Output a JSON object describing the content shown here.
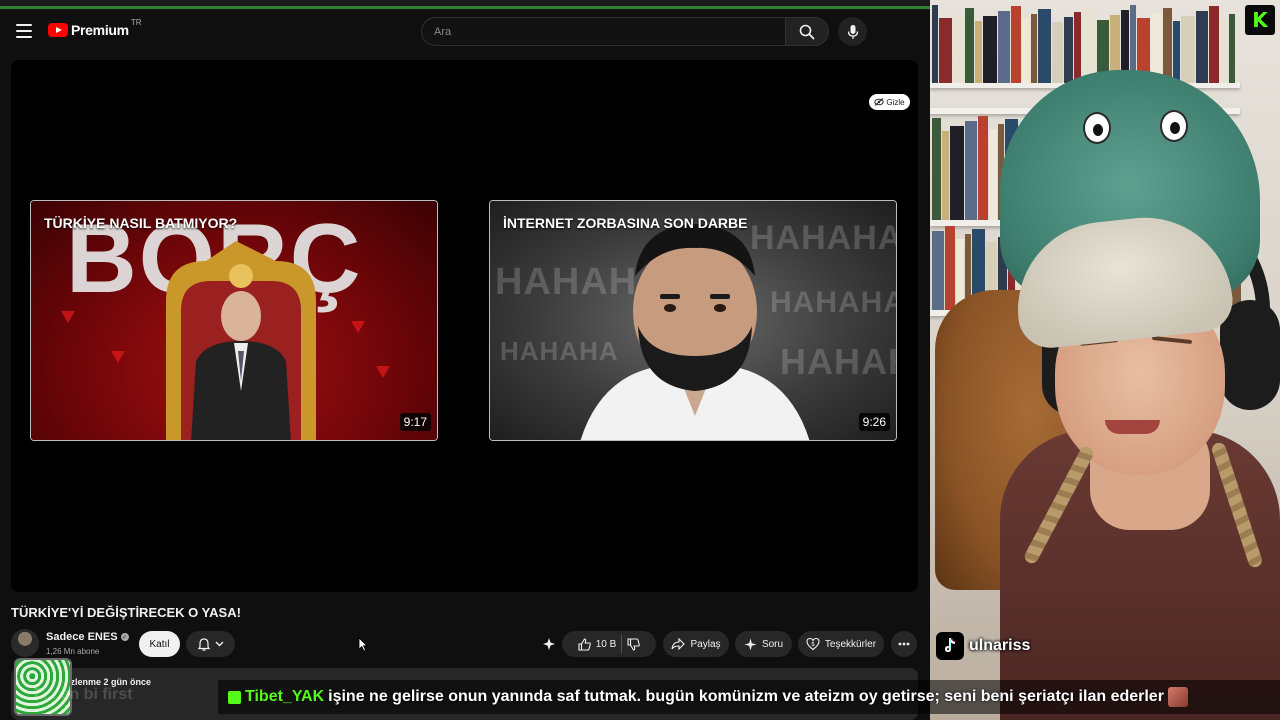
{
  "browser": {
    "progress_pct": 100
  },
  "header": {
    "logo_text": "Premium",
    "logo_region": "TR",
    "search_placeholder": "Ara"
  },
  "player": {
    "hide_label": "Gizle",
    "endcards": [
      {
        "title": "TÜRKİYE NASIL BATMIYOR?",
        "big_word": "BORÇ",
        "duration": "9:17"
      },
      {
        "title": "İNTERNET ZORBASINA SON DARBE",
        "background_word": "HAHAHA",
        "duration": "9:26"
      }
    ]
  },
  "video": {
    "title": "TÜRKİYE'Yİ DEĞİŞTİRECEK O YASA!",
    "channel_name": "Sadece ENES",
    "subscribers": "1,26 Mn abone",
    "join_label": "Katıl",
    "like_count": "10 B",
    "share_label": "Paylaş",
    "ask_label": "Soru",
    "thanks_label": "Teşekkürler",
    "description_meta": "izlenme  2 gün önce"
  },
  "stream": {
    "tiktok_name": "ulnariss",
    "kick_letter": "K",
    "ghost_chat": "Z... en bi first",
    "chat": {
      "user": "Tibet_YAK",
      "message": "işine ne gelirse onun yanında saf tutmak. bugün komünizm ve ateizm oy getirse; seni beni şeriatçı ilan ederler"
    }
  },
  "colors": {
    "kick_green": "#53fc18",
    "youtube_red": "#ff0000",
    "background": "#0f0f0f"
  }
}
